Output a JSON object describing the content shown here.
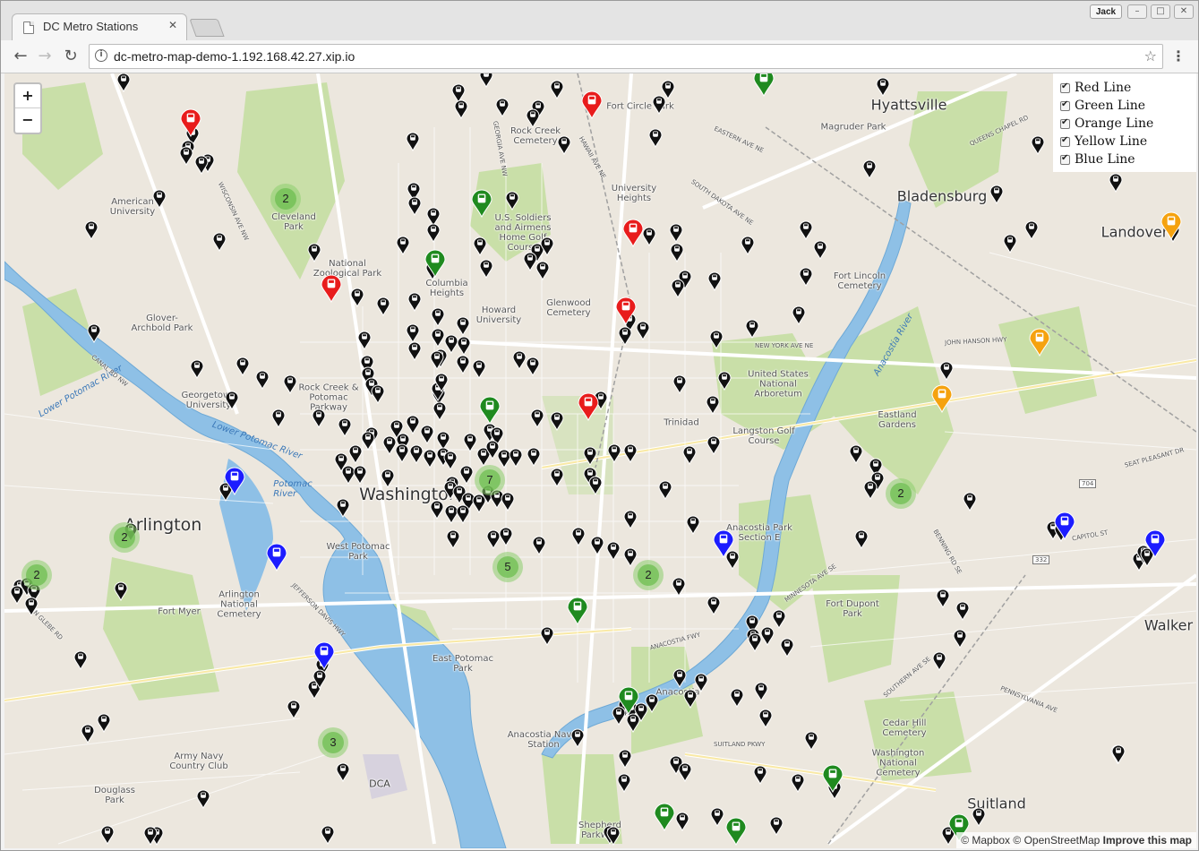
{
  "browser": {
    "tab_title": "DC Metro Stations",
    "tab_close": "✕",
    "profile_name": "Jack",
    "url": "dc-metro-map-demo-1.192.168.42.27.xip.io",
    "info_icon": "i",
    "back_icon": "←",
    "forward_icon": "→",
    "reload_icon": "↻",
    "star_icon": "☆",
    "menu_icon": "⋮",
    "minimize_icon": "–",
    "maximize_icon": "□",
    "close_icon": "✕"
  },
  "map": {
    "zoom_in": "+",
    "zoom_out": "−",
    "layers": [
      {
        "label": "Red Line",
        "checked": true
      },
      {
        "label": "Green Line",
        "checked": true
      },
      {
        "label": "Orange Line",
        "checked": true
      },
      {
        "label": "Yellow Line",
        "checked": true
      },
      {
        "label": "Blue Line",
        "checked": true
      }
    ],
    "attribution": {
      "mapbox": "© Mapbox",
      "osm": "© OpenStreetMap",
      "improve": "Improve this map"
    },
    "line_colors": {
      "red": "#e81c1c",
      "green": "#1f8a1f",
      "orange": "#f5a20f",
      "yellow": "#f2d500",
      "blue": "#1c1cff",
      "bus": "#111111"
    },
    "places": {
      "washington": "Washington",
      "arlington": "Arlington",
      "hyattsville": "Hyattsville",
      "bladensburg": "Bladensburg",
      "landover": "Landover",
      "walker": "Walker",
      "suitland": "Suitland",
      "dca": "DCA",
      "cleveland_park": "Cleveland\nPark",
      "columbia_heights": "Columbia\nHeights",
      "trinidad": "Trinidad",
      "anacostia": "Anacostia",
      "fort_myer": "Fort Myer",
      "douglass_park": "Douglass\nPark",
      "eastland_gardens": "Eastland\nGardens",
      "american_university": "American\nUniversity",
      "georgetown_university": "Georgetown\nUniversity",
      "howard_university": "Howard\nUniversity",
      "university_heights": "University\nHeights",
      "arlington_cemetery": "Arlington\nNational\nCemetery",
      "us_arboretum": "United States\nNational\nArboretum",
      "glenwood_cemetery": "Glenwood\nCemetery",
      "rock_creek_cemetery": "Rock Creek\nCemetery",
      "fort_lincoln_cemetery": "Fort Lincoln\nCemetery",
      "magruder_park": "Magruder Park",
      "fort_circle_park": "Fort Circle Park",
      "glover_archbold": "Glover-\nArchbold Park",
      "rock_creek_parkway": "Rock Creek &\nPotomac\nParkway",
      "west_potomac": "West Potomac\nPark",
      "east_potomac": "East Potomac\nPark",
      "langston_golf": "Langston Golf\nCourse",
      "anacostia_park": "Anacostia Park\nSection E",
      "fort_dupont": "Fort Dupont\nPark",
      "anacostia_station": "Anacostia Naval\nStation",
      "army_navy": "Army Navy\nCountry Club",
      "cedar_hill": "Cedar Hill\nCemetery",
      "washington_national_cemetery": "Washington\nNational\nCemetery",
      "shepherd_parkway": "Shepherd\nParkway",
      "soldiers_home": "U.S. Soldiers\nand Airmens\nHome Golf\nCourse",
      "national_zoo": "National\nZoological Park",
      "potomac_river": "Potomac\nRiver",
      "lower_potomac_1": "Lower Potomac River",
      "lower_potomac_2": "Lower Potomac River",
      "anacostia_river": "Anacostia River"
    },
    "roads": {
      "new_york_ave": "NEW YORK AVE NE",
      "eastern_ave": "EASTERN AVE NE",
      "dakota_ave": "SOUTH DAKOTA AVE NE",
      "wisconsin_ave": "WISCONSIN AVE NW",
      "canal_rd": "CANAL RD NW",
      "suitland_pkwy": "SUITLAND PKWY",
      "pennsylvania_ave": "PENNSYLVANIA AVE",
      "john_hanson_hwy": "JOHN HANSON HWY",
      "capitol_st": "CAPITOL ST",
      "georgia_ave": "GEORGIA AVE NW",
      "hawaii_ave": "HAWAII AVE NE",
      "queens_chapel": "QUEENS CHAPEL RD",
      "minnesota_ave": "MINNESOTA AVE SE",
      "benning_rd": "BENNING RD SE",
      "southern_ave": "SOUTHERN AVE SE",
      "anacostia_fwy": "ANACOSTIA FWY",
      "jefferson_davis": "JEFFERSON DAVIS HWY",
      "glebe_rd": "N GLEBE RD",
      "seat_pleasant": "SEAT PLEASANT DR",
      "route_704": "704",
      "route_332": "332"
    },
    "clusters": [
      {
        "id": "cl-cleveland",
        "count": "2"
      },
      {
        "id": "cl-arlington",
        "count": "2"
      },
      {
        "id": "cl-west",
        "count": "2"
      },
      {
        "id": "cl-downtown",
        "count": "7"
      },
      {
        "id": "cl-mall",
        "count": "5"
      },
      {
        "id": "cl-navy",
        "count": "2"
      },
      {
        "id": "cl-east",
        "count": "2"
      },
      {
        "id": "cl-south",
        "count": "3"
      }
    ]
  }
}
